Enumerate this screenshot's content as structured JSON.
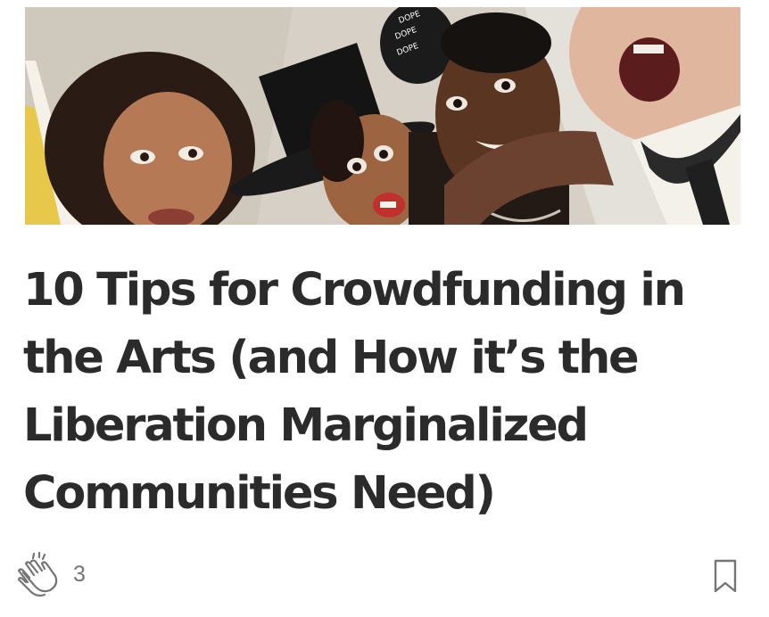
{
  "article": {
    "image_alt": "Four performers making funny faces in a selfie",
    "title": "10 Tips for Crowdfunding in the Arts (and How it’s the Liberation Marginalized Communities Need)",
    "claps": "3"
  },
  "icons": {
    "clap": "clap-hands-icon",
    "bookmark": "bookmark-icon"
  },
  "colors": {
    "title": "#2b2b2b",
    "meta": "#757575"
  }
}
